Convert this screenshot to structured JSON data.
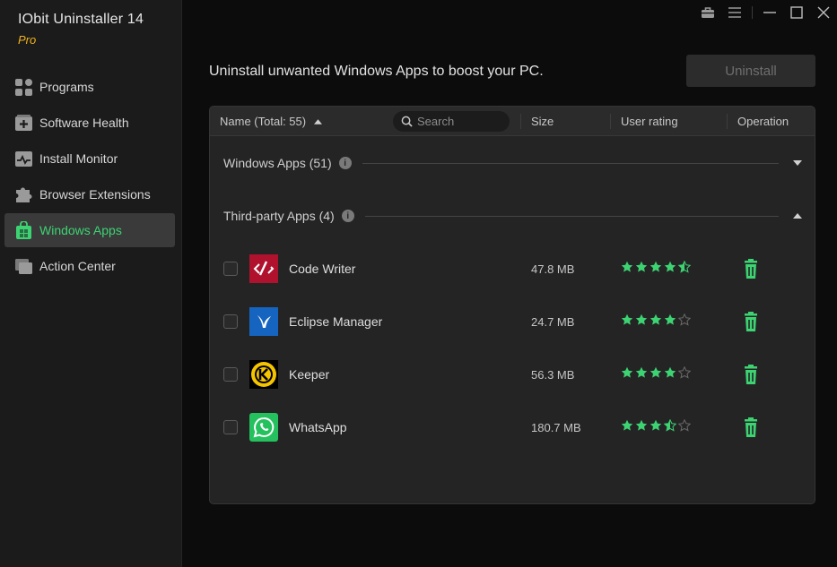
{
  "app": {
    "title": "IObit Uninstaller 14",
    "edition": "Pro"
  },
  "colors": {
    "accent": "#3dd373",
    "edition": "#f0b21a"
  },
  "sidebar": {
    "items": [
      {
        "label": "Programs",
        "icon": "programs-icon",
        "active": false
      },
      {
        "label": "Software Health",
        "icon": "software-health-icon",
        "active": false
      },
      {
        "label": "Install Monitor",
        "icon": "install-monitor-icon",
        "active": false
      },
      {
        "label": "Browser Extensions",
        "icon": "puzzle-icon",
        "active": false
      },
      {
        "label": "Windows Apps",
        "icon": "windows-apps-icon",
        "active": true
      },
      {
        "label": "Action Center",
        "icon": "action-center-icon",
        "active": false
      }
    ]
  },
  "titlebar": {
    "icons": [
      "toolbox-icon",
      "menu-icon",
      "minimize-icon",
      "maximize-icon",
      "close-icon"
    ]
  },
  "main": {
    "headline": "Uninstall unwanted Windows Apps to boost your PC.",
    "uninstall_label": "Uninstall"
  },
  "table": {
    "columns": {
      "name": "Name (Total: 55)",
      "size": "Size",
      "rating": "User rating",
      "operation": "Operation"
    },
    "search_placeholder": "Search",
    "sort": "ascending",
    "groups": [
      {
        "label": "Windows Apps (51)",
        "expanded": false
      },
      {
        "label": "Third-party Apps (4)",
        "expanded": true
      }
    ],
    "rows": [
      {
        "name": "Code Writer",
        "size": "47.8 MB",
        "rating": 4.5,
        "icon": "code-writer-icon",
        "checked": false
      },
      {
        "name": "Eclipse Manager",
        "size": "24.7 MB",
        "rating": 4,
        "icon": "eclipse-manager-icon",
        "checked": false
      },
      {
        "name": "Keeper",
        "size": "56.3 MB",
        "rating": 4,
        "icon": "keeper-icon",
        "checked": false
      },
      {
        "name": "WhatsApp",
        "size": "180.7 MB",
        "rating": 3.5,
        "icon": "whatsapp-icon",
        "checked": false
      }
    ]
  }
}
